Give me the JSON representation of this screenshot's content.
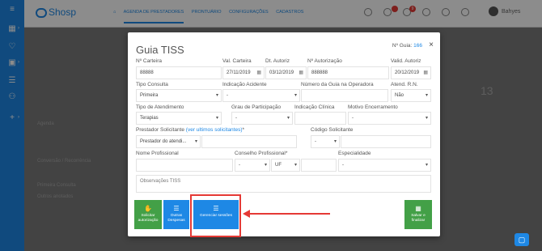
{
  "app": {
    "brand": "Shosp",
    "nav": [
      "AGENDA DE PRESTADORES",
      "PRONTUÁRIO",
      "CONFIGURAÇÕES",
      "CADASTROS"
    ],
    "notification_badges": [
      "9"
    ],
    "user_name": "Bahyes",
    "accent_color": "#1e88e5"
  },
  "modal": {
    "title": "Guia TISS",
    "guia_label": "Nº Guia:",
    "guia_number": "166",
    "close": "×",
    "fields": {
      "numero_carteira": {
        "label": "Nº Carteira",
        "value": "88888"
      },
      "val_carteira": {
        "label": "Val. Carteira",
        "value": "27/11/2019"
      },
      "dt_autoriz": {
        "label": "Dt. Autoriz",
        "value": "03/12/2019"
      },
      "numero_autorizacao": {
        "label": "Nº Autorização",
        "value": "888888"
      },
      "valid_autoriz": {
        "label": "Valid. Autoriz",
        "value": "20/12/2019"
      },
      "tipo_consulta": {
        "label": "Tipo Consulta",
        "value": "Primeira"
      },
      "indicacao_acidente": {
        "label": "Indicação Acidente",
        "value": "-"
      },
      "numero_guia_operadora": {
        "label": "Número da Guia na Operadora",
        "value": ""
      },
      "atend_rn": {
        "label": "Atend. R.N.",
        "value": "Não"
      },
      "tipo_atendimento": {
        "label": "Tipo de Atendimento",
        "value": "Terapias"
      },
      "grau_participacao": {
        "label": "Grau de Participação",
        "value": "-"
      },
      "indicacao_clinica": {
        "label": "Indicação Clínica",
        "value": ""
      },
      "motivo_encerramento": {
        "label": "Motivo Encerramento",
        "value": "-"
      },
      "prestador_solicitante": {
        "label": "Prestador Solicitante",
        "link": "(ver ultimos solicitantes)",
        "suffix": "*",
        "value": "Prestador do atendi..."
      },
      "codigo_solicitante": {
        "label": "Código Solicitante",
        "value": "-"
      },
      "nome_profissional": {
        "label": "Nome Profissional",
        "value": ""
      },
      "conselho_profissional": {
        "label": "Conselho Profissional*",
        "value": "-",
        "uf": "UF"
      },
      "especialidade": {
        "label": "Especialidade",
        "value": "-"
      },
      "observacoes": {
        "placeholder": "Observações TISS"
      }
    },
    "buttons": {
      "solicitar": "Solicitar autorização",
      "outras_despesas": "Outras Despesas",
      "gerenciar_sessoes": "Gerenciar sessões",
      "salvar": "Salvar e finalizar"
    }
  },
  "background": {
    "calendar_day": "13",
    "side_texts": [
      "Agenda",
      "Conversão / Recorrência",
      "Primeira Consulta",
      "Outros anotados"
    ]
  },
  "colors": {
    "green": "#43a047",
    "blue": "#1e88e5",
    "highlight": "#e53935"
  }
}
